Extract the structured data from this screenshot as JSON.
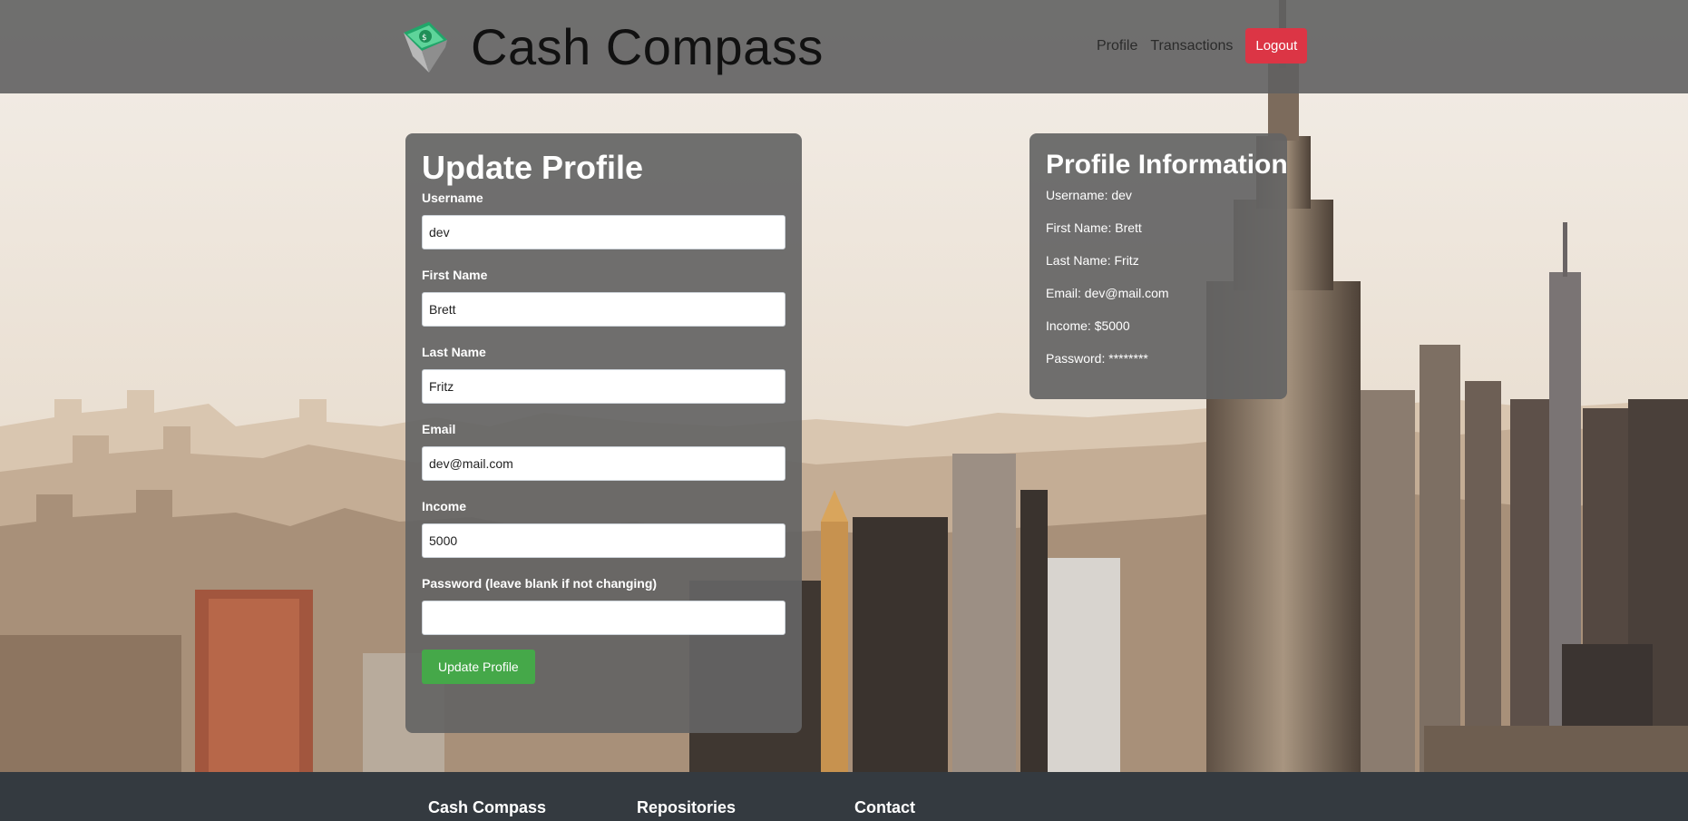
{
  "header": {
    "brand": "Cash Compass",
    "nav": {
      "profile": "Profile",
      "transactions": "Transactions",
      "logout": "Logout"
    }
  },
  "update_form": {
    "title": "Update Profile",
    "fields": {
      "username": {
        "label": "Username",
        "value": "dev"
      },
      "first_name": {
        "label": "First Name",
        "value": "Brett"
      },
      "last_name": {
        "label": "Last Name",
        "value": "Fritz"
      },
      "email": {
        "label": "Email",
        "value": "dev@mail.com"
      },
      "income": {
        "label": "Income",
        "value": "5000"
      },
      "password": {
        "label": "Password (leave blank if not changing)",
        "value": ""
      }
    },
    "submit_label": "Update Profile"
  },
  "profile_info": {
    "title": "Profile Information",
    "lines": [
      "Username: dev",
      "First Name: Brett",
      "Last Name: Fritz",
      "Email: dev@mail.com",
      "Income: $5000",
      "Password: ********"
    ]
  },
  "footer": {
    "columns": [
      "Cash Compass",
      "Repositories",
      "Contact"
    ]
  },
  "colors": {
    "header_bg": "#606060",
    "card_bg": "#646464",
    "logout": "#dc3545",
    "submit": "#45a849",
    "footer_bg": "#343a40"
  }
}
